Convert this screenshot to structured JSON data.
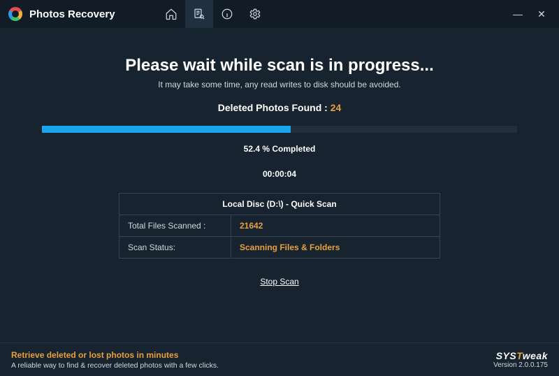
{
  "app": {
    "title": "Photos Recovery"
  },
  "scan": {
    "heading": "Please wait while scan is in progress...",
    "subheading": "It may take some time, any read writes to disk should be avoided.",
    "found_label": "Deleted Photos Found : ",
    "found_count": "24",
    "percent_text": "52.4 % Completed",
    "percent_value": "52.4",
    "elapsed": "00:00:04",
    "panel_header": "Local Disc (D:\\) - Quick Scan",
    "total_files_label": "Total Files Scanned :",
    "total_files_value": "21642",
    "status_label": "Scan Status:",
    "status_value": "Scanning Files & Folders",
    "stop_label": "Stop Scan"
  },
  "footer": {
    "title": "Retrieve deleted or lost photos in minutes",
    "sub": "A reliable way to find & recover deleted photos with a few clicks.",
    "brand_prefix": "SYS",
    "brand_accent": "T",
    "brand_suffix": "weak",
    "version": "Version 2.0.0.175"
  }
}
